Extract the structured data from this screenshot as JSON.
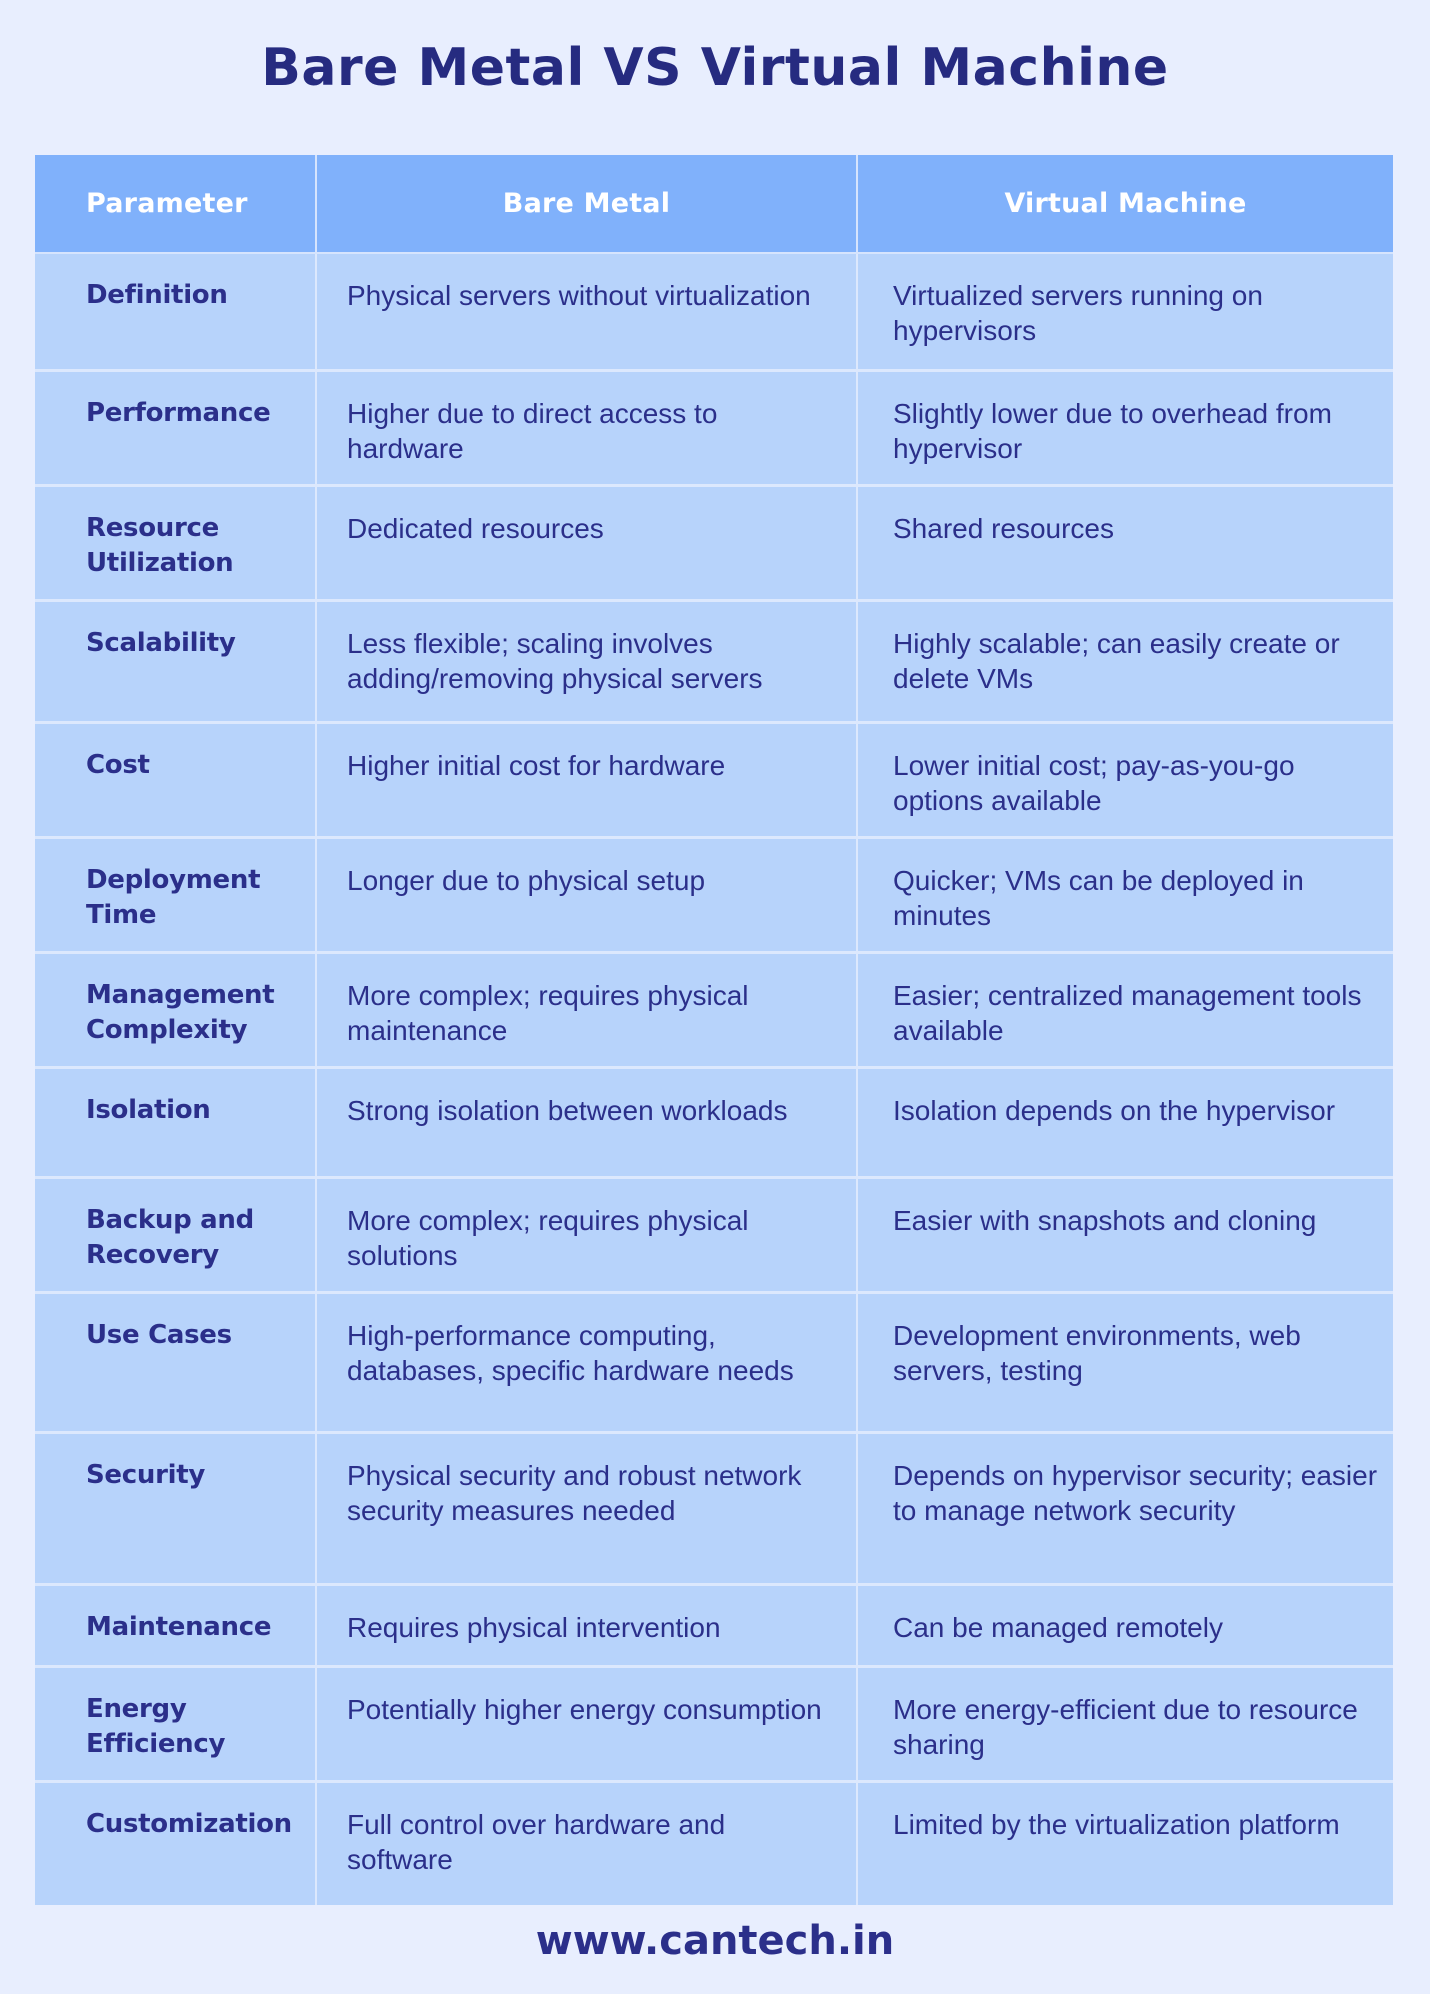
{
  "title": "Bare Metal VS Virtual Machine",
  "table": {
    "headers": [
      "Parameter",
      "Bare Metal",
      "Virtual Machine"
    ],
    "rows": [
      {
        "parameter": "Definition",
        "bare_metal": "Physical servers without virtualization",
        "virtual_machine": "Virtualized servers running on hypervisors"
      },
      {
        "parameter": "Performance",
        "bare_metal": "Higher due to direct access to hardware",
        "virtual_machine": "Slightly lower due to overhead from hypervisor"
      },
      {
        "parameter": "Resource Utilization",
        "bare_metal": "Dedicated resources",
        "virtual_machine": "Shared resources"
      },
      {
        "parameter": "Scalability",
        "bare_metal": "Less flexible; scaling involves adding/removing physical servers",
        "virtual_machine": "Highly scalable; can easily create or delete VMs"
      },
      {
        "parameter": "Cost",
        "bare_metal": "Higher initial cost for hardware",
        "virtual_machine": "Lower initial cost; pay-as-you-go options available"
      },
      {
        "parameter": "Deployment Time",
        "bare_metal": "Longer due to physical setup",
        "virtual_machine": "Quicker; VMs can be deployed in minutes"
      },
      {
        "parameter": "Management Complexity",
        "bare_metal": "More complex; requires physical maintenance",
        "virtual_machine": "Easier; centralized management tools available"
      },
      {
        "parameter": "Isolation",
        "bare_metal": "Strong isolation between workloads",
        "virtual_machine": "Isolation depends on the hypervisor"
      },
      {
        "parameter": "Backup and Recovery",
        "bare_metal": "More complex; requires physical solutions",
        "virtual_machine": "Easier with snapshots and cloning"
      },
      {
        "parameter": "Use Cases",
        "bare_metal": "High-performance computing, databases, specific hardware needs",
        "virtual_machine": "Development environments, web servers, testing"
      },
      {
        "parameter": "Security",
        "bare_metal": "Physical security and robust network security measures needed",
        "virtual_machine": "Depends on hypervisor security; easier to manage network security"
      },
      {
        "parameter": "Maintenance",
        "bare_metal": "Requires physical intervention",
        "virtual_machine": "Can be managed remotely"
      },
      {
        "parameter": "Energy Efficiency",
        "bare_metal": "Potentially higher energy consumption",
        "virtual_machine": "More energy-efficient due to resource sharing"
      },
      {
        "parameter": "Customization",
        "bare_metal": "Full control over hardware and software",
        "virtual_machine": "Limited by the virtualization platform"
      }
    ]
  },
  "footer": {
    "website": "www.cantech.in"
  },
  "colors": {
    "background": "#e8eefe",
    "header_fill": "#80b1fb",
    "row_fill": "#b7d3fb",
    "text": "#2b2f8a",
    "title": "#262b80"
  }
}
